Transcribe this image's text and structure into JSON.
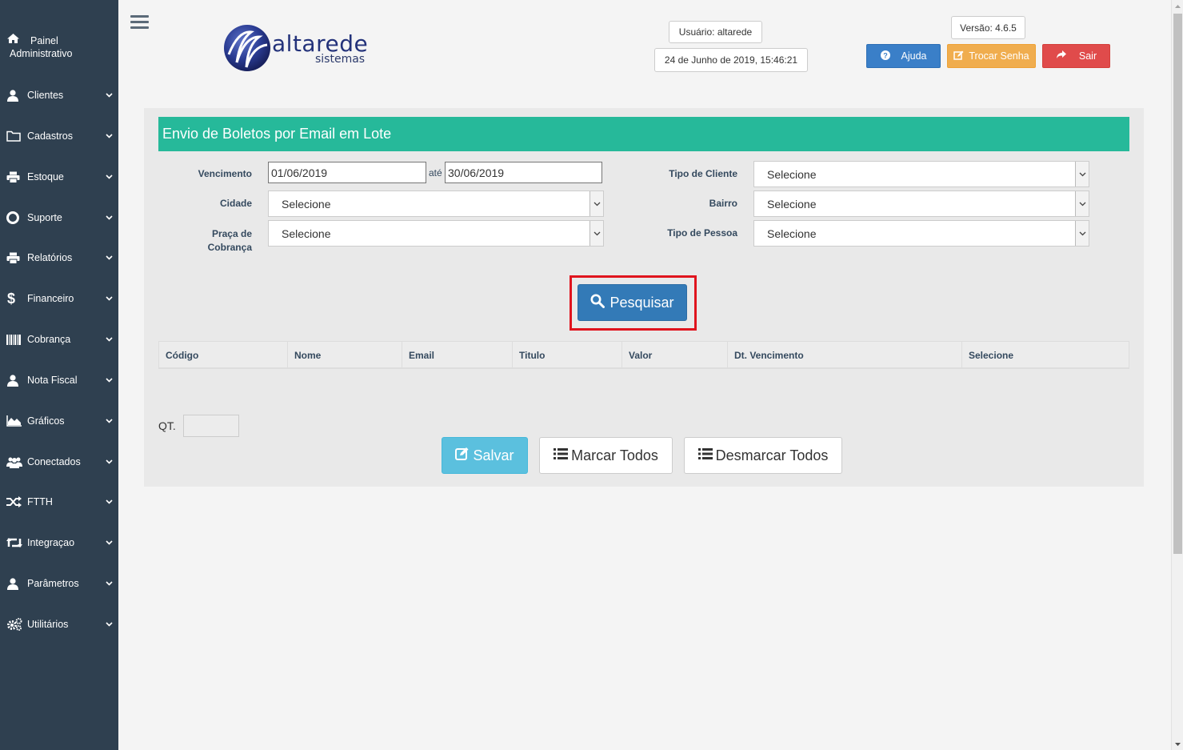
{
  "sidebar": {
    "home": {
      "line1": "Painel",
      "line2": "Administrativo"
    },
    "items": [
      {
        "label": "Clientes",
        "icon": "user-icon"
      },
      {
        "label": "Cadastros",
        "icon": "folder-icon"
      },
      {
        "label": "Estoque",
        "icon": "printer-icon"
      },
      {
        "label": "Suporte",
        "icon": "lifebuoy-icon"
      },
      {
        "label": "Relatórios",
        "icon": "printer-icon"
      },
      {
        "label": "Financeiro",
        "icon": "dollar-icon"
      },
      {
        "label": "Cobrança",
        "icon": "barcode-icon"
      },
      {
        "label": "Nota Fiscal",
        "icon": "user-icon"
      },
      {
        "label": "Gráficos",
        "icon": "area-chart-icon"
      },
      {
        "label": "Conectados",
        "icon": "users-icon"
      },
      {
        "label": "FTTH",
        "icon": "random-icon"
      },
      {
        "label": "Integraçao",
        "icon": "retweet-icon"
      },
      {
        "label": "Parâmetros",
        "icon": "user-icon"
      },
      {
        "label": "Utilitários",
        "icon": "cogs-icon"
      }
    ]
  },
  "header": {
    "logo_text": "altarede",
    "logo_sub": "sistemas",
    "user": "Usuário: altarede",
    "datetime": "24 de Junho de 2019, 15:46:21",
    "version": "Versão: 4.6.5",
    "btn_ajuda": "Ajuda",
    "btn_trocar": "Trocar Senha",
    "btn_sair": "Sair"
  },
  "form": {
    "title": "Envio de Boletos por Email em Lote",
    "vencimento_label": "Vencimento",
    "venc_from": "01/06/2019",
    "ate": "até",
    "venc_to": "30/06/2019",
    "cidade_label": "Cidade",
    "cidade_value": "Selecione",
    "praca_label_1": "Praça de",
    "praca_label_2": "Cobrança",
    "praca_value": "Selecione",
    "tipo_cliente_label": "Tipo de Cliente",
    "tipo_cliente_value": "Selecione",
    "bairro_label": "Bairro",
    "bairro_value": "Selecione",
    "tipo_pessoa_label": "Tipo de Pessoa",
    "tipo_pessoa_value": "Selecione",
    "pesquisar": "Pesquisar"
  },
  "table": {
    "columns": [
      "Código",
      "Nome",
      "Email",
      "Titulo",
      "Valor",
      "Dt. Vencimento",
      "Selecione"
    ]
  },
  "footer": {
    "qt_label": "QT.",
    "qt_value": "",
    "salvar": "Salvar",
    "marcar": "Marcar Todos",
    "desmarcar": "Desmarcar Todos"
  },
  "colors": {
    "sidebar": "#2f4050",
    "title_bar": "#26b99a",
    "primary": "#337ab7",
    "highlight": "#e0141e"
  }
}
